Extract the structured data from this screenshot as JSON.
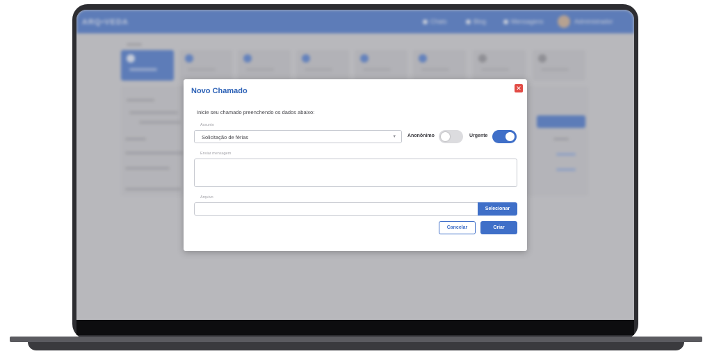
{
  "app": {
    "logo_text": "ARQ•VEDA",
    "topbar_links": [
      "Chats",
      "Blog",
      "Mensagens",
      "Administrador"
    ]
  },
  "modal": {
    "title": "Novo Chamado",
    "close_icon": "close-icon",
    "intro": "Inicie seu chamado preenchendo os dados abaixo:",
    "subject_label": "Assunto",
    "subject_value": "Solicitação de férias",
    "anonymous_label": "Anonônimo",
    "anonymous_on": false,
    "urgent_label": "Urgente",
    "urgent_on": true,
    "message_label": "Enviar mensagem",
    "message_value": "",
    "files_label": "Arquivo",
    "files_value": "",
    "select_label": "Selecionar",
    "cancel_label": "Cancelar",
    "create_label": "Criar"
  },
  "colors": {
    "primary": "#3f6fc8",
    "title": "#2f63b7",
    "close": "#e24b45"
  }
}
